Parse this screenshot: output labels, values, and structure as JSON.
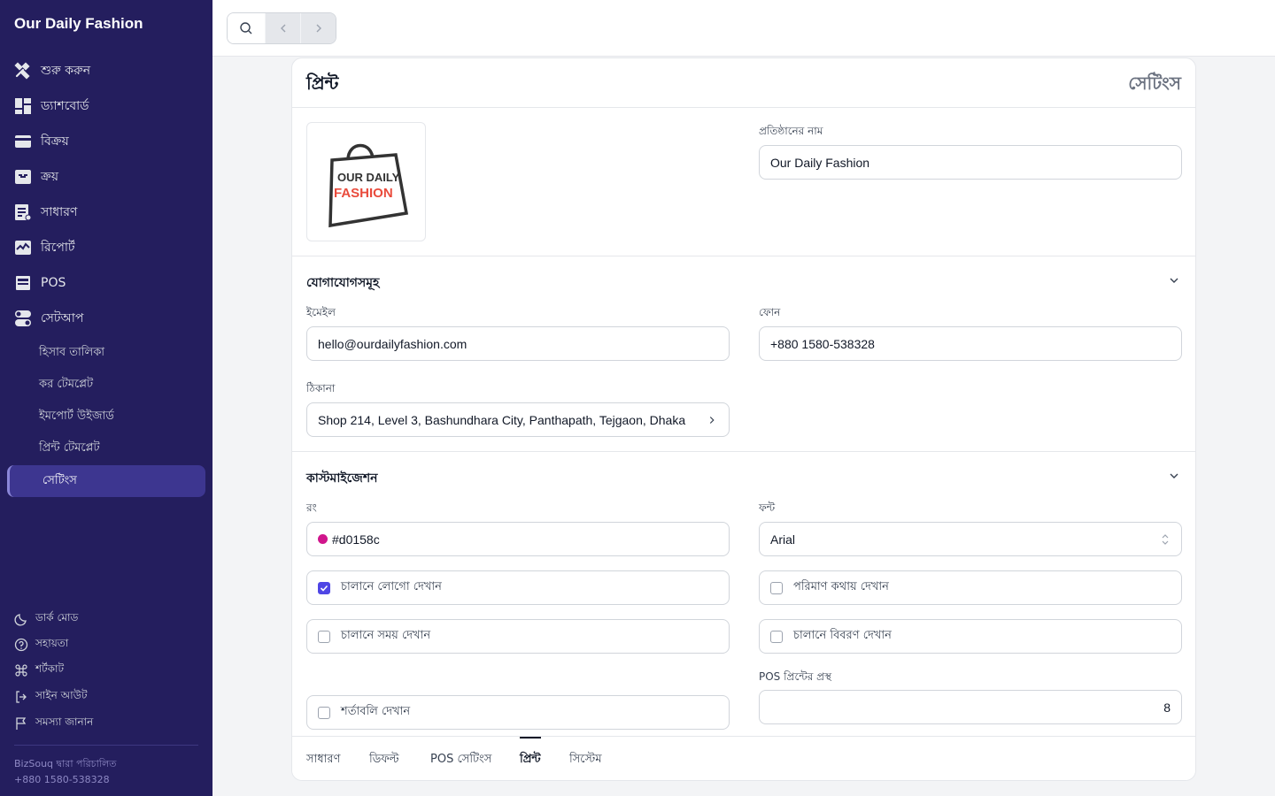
{
  "app": {
    "brand": "Our Daily Fashion"
  },
  "sidebar": {
    "items": [
      {
        "label": "শুরু করুন",
        "icon": "tools-icon"
      },
      {
        "label": "ড্যাশবোর্ড",
        "icon": "dashboard-icon"
      },
      {
        "label": "বিক্রয়",
        "icon": "card-icon"
      },
      {
        "label": "ক্রয়",
        "icon": "inbox-icon"
      },
      {
        "label": "সাধারণ",
        "icon": "list-icon"
      },
      {
        "label": "রিপোর্ট",
        "icon": "chart-icon"
      },
      {
        "label": "POS",
        "icon": "pos-icon"
      },
      {
        "label": "সেটআপ",
        "icon": "toggle-icon"
      }
    ],
    "sub_items": [
      {
        "label": "হিসাব তালিকা"
      },
      {
        "label": "কর টেমপ্লেট"
      },
      {
        "label": "ইমপোর্ট উইজার্ড"
      },
      {
        "label": "প্রিন্ট টেমপ্লেট"
      },
      {
        "label": "সেটিংস",
        "active": true
      }
    ],
    "footer": [
      {
        "label": "ডার্ক মোড",
        "icon": "moon-icon"
      },
      {
        "label": "সহায়তা",
        "icon": "help-icon"
      },
      {
        "label": "শর্টকাট",
        "icon": "command-icon"
      },
      {
        "label": "সাইন আউট",
        "icon": "logout-icon"
      },
      {
        "label": "সমস্যা জানান",
        "icon": "flag-icon"
      }
    ],
    "powered_by": "BizSouq দ্বারা পরিচালিত",
    "phone": "+880 1580-538328"
  },
  "page": {
    "title": "প্রিন্ট",
    "right_title": "সেটিংস",
    "logo_text_top": "OUR DAILY",
    "logo_text_bottom": "FASHION",
    "company_name_label": "প্রতিষ্ঠানের নাম",
    "company_name": "Our Daily Fashion"
  },
  "contacts": {
    "title": "যোগাযোগসমূহ",
    "email_label": "ইমেইল",
    "email": "hello@ourdailyfashion.com",
    "phone_label": "ফোন",
    "phone": "+880 1580-538328",
    "address_label": "ঠিকানা",
    "address": "Shop 214, Level 3, Bashundhara City, Panthapath, Tejgaon, Dhaka"
  },
  "customization": {
    "title": "কাস্টমাইজেশন",
    "color_label": "রং",
    "color": "#d0158c",
    "font_label": "ফন্ট",
    "font": "Arial",
    "show_logo": "চালানে লোগো দেখান",
    "show_logo_checked": true,
    "show_amount_words": "পরিমাণ কথায় দেখান",
    "show_time": "চালানে সময় দেখান",
    "show_description": "চালানে বিবরণ দেখান",
    "pos_width_label": "POS প্রিন্টের প্রস্থ",
    "pos_width": "8",
    "show_terms": "শর্তাবলি দেখান"
  },
  "tabs": [
    {
      "label": "সাধারণ"
    },
    {
      "label": "ডিফল্ট"
    },
    {
      "label": "POS সেটিংস"
    },
    {
      "label": "প্রিন্ট",
      "active": true
    },
    {
      "label": "সিস্টেম"
    }
  ]
}
